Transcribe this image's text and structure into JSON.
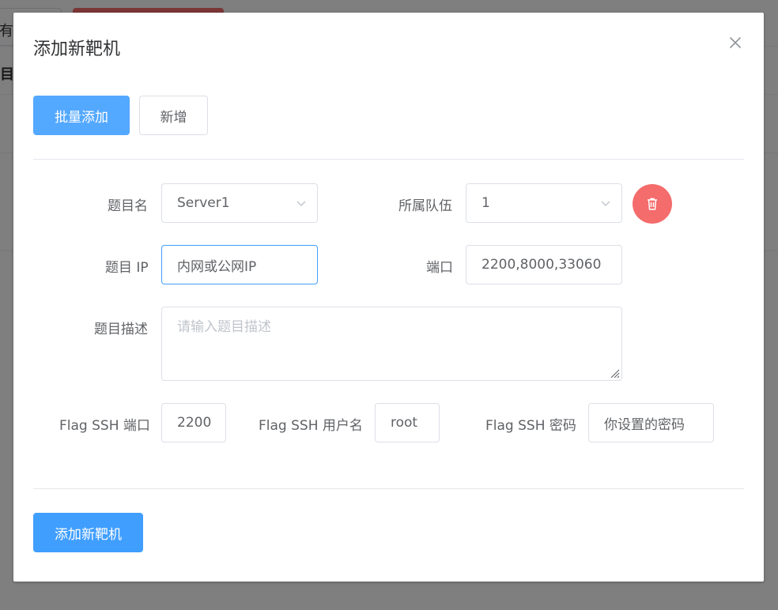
{
  "background": {
    "outline_button_text": "有",
    "header_text": "目 I"
  },
  "dialog": {
    "title": "添加新靶机",
    "close_icon": "close-icon"
  },
  "toolbar": {
    "batch_add_label": "批量添加",
    "add_label": "新增"
  },
  "form": {
    "challenge_name": {
      "label": "题目名",
      "value": "Server1"
    },
    "team": {
      "label": "所属队伍",
      "value": "1"
    },
    "delete_icon": "trash-icon",
    "challenge_ip": {
      "label": "题目 IP",
      "value": "内网或公网IP"
    },
    "port": {
      "label": "端口",
      "value": "2200,8000,33060"
    },
    "description": {
      "label": "题目描述",
      "value": "",
      "placeholder": "请输入题目描述"
    },
    "flag_ssh_port": {
      "label": "Flag SSH 端口",
      "value": "2200"
    },
    "flag_ssh_user": {
      "label": "Flag SSH 用户名",
      "value": "root"
    },
    "flag_ssh_password": {
      "label": "Flag SSH 密码",
      "value": "你设置的密码"
    }
  },
  "footer": {
    "submit_label": "添加新靶机"
  },
  "colors": {
    "primary": "#409eff",
    "danger": "#f56c6c",
    "border": "#dcdfe6",
    "placeholder": "#c0c4cc"
  }
}
